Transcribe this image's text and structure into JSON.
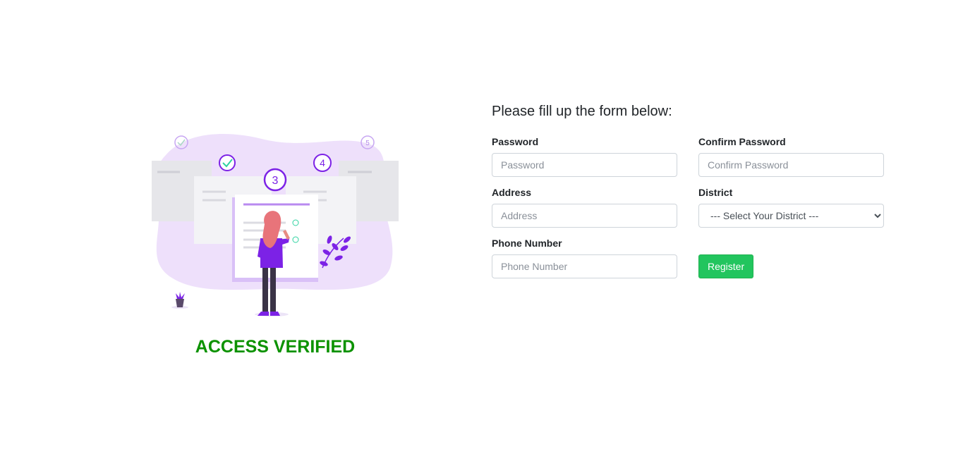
{
  "colors": {
    "accent_green": "#22c55e",
    "verified_green": "#0c9200",
    "illustration_purple": "#7c22e6",
    "illustration_lilac": "#eee0fb",
    "check_teal": "#2ed3a0"
  },
  "illustration": {
    "step_numbers": [
      "3",
      "4",
      "5"
    ],
    "icon": "checklist-woman-illustration"
  },
  "status": {
    "text": "ACCESS VERIFIED"
  },
  "form": {
    "title": "Please fill up the form below:",
    "password": {
      "label": "Password",
      "placeholder": "Password",
      "value": ""
    },
    "confirm_password": {
      "label": "Confirm Password",
      "placeholder": "Confirm Password",
      "value": ""
    },
    "address": {
      "label": "Address",
      "placeholder": "Address",
      "value": ""
    },
    "district": {
      "label": "District",
      "selected": "--- Select Your District ---"
    },
    "phone": {
      "label": "Phone Number",
      "placeholder": "Phone Number",
      "value": ""
    },
    "register_label": "Register"
  }
}
